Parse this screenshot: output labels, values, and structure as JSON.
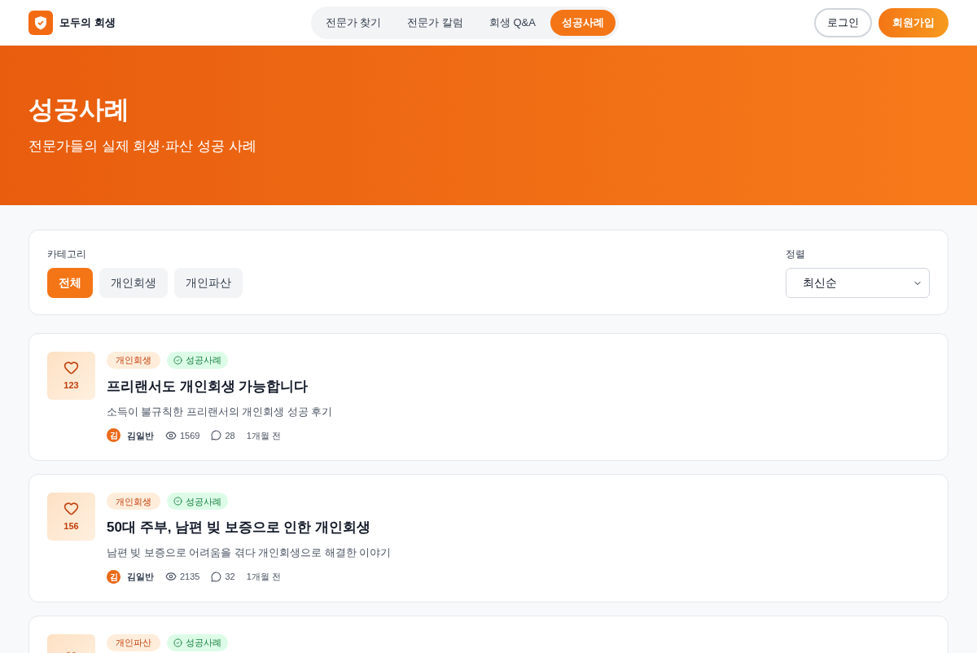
{
  "brand": "모두의 회생",
  "nav": [
    {
      "label": "전문가 찾기",
      "selected": false
    },
    {
      "label": "전문가 칼럼",
      "selected": false
    },
    {
      "label": "회생 Q&A",
      "selected": false
    },
    {
      "label": "성공사례",
      "selected": true
    }
  ],
  "auth": {
    "login": "로그인",
    "signup": "회원가입"
  },
  "hero": {
    "title": "성공사례",
    "subtitle": "전문가들의 실제 회생·파산 성공 사례"
  },
  "filters": {
    "category_label": "카테고리",
    "categories": [
      {
        "label": "전체",
        "selected": true
      },
      {
        "label": "개인회생",
        "selected": false
      },
      {
        "label": "개인파산",
        "selected": false
      }
    ],
    "sort_label": "정렬",
    "sort_value": "최신순"
  },
  "posts": [
    {
      "likes": "123",
      "category": "개인회생",
      "badge": "성공사례",
      "title": "프리랜서도 개인회생 가능합니다",
      "summary": "소득이 불규칙한 프리랜서의 개인회생 성공 후기",
      "avatar": "김",
      "author": "김일반",
      "views": "1569",
      "comments": "28",
      "time": "1개월 전"
    },
    {
      "likes": "156",
      "category": "개인회생",
      "badge": "성공사례",
      "title": "50대 주부, 남편 빚 보증으로 인한 개인회생",
      "summary": "남편 빚 보증으로 어려움을 겪다 개인회생으로 해결한 이야기",
      "avatar": "김",
      "author": "김일반",
      "views": "2135",
      "comments": "32",
      "time": "1개월 전"
    },
    {
      "category": "개인파산",
      "badge": "성공사례"
    }
  ]
}
